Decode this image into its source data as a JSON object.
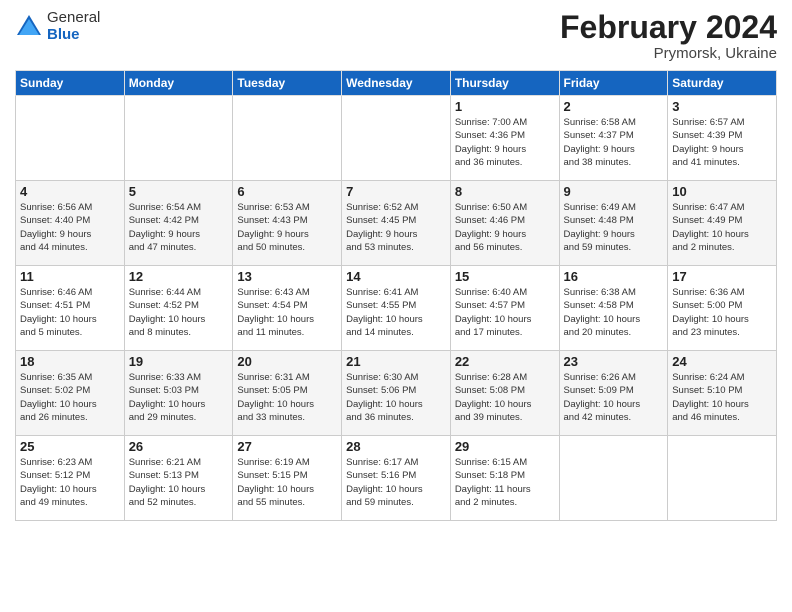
{
  "header": {
    "logo_general": "General",
    "logo_blue": "Blue",
    "month_title": "February 2024",
    "subtitle": "Prymorsk, Ukraine"
  },
  "days_of_week": [
    "Sunday",
    "Monday",
    "Tuesday",
    "Wednesday",
    "Thursday",
    "Friday",
    "Saturday"
  ],
  "weeks": [
    [
      {
        "day": "",
        "info": ""
      },
      {
        "day": "",
        "info": ""
      },
      {
        "day": "",
        "info": ""
      },
      {
        "day": "",
        "info": ""
      },
      {
        "day": "1",
        "info": "Sunrise: 7:00 AM\nSunset: 4:36 PM\nDaylight: 9 hours\nand 36 minutes."
      },
      {
        "day": "2",
        "info": "Sunrise: 6:58 AM\nSunset: 4:37 PM\nDaylight: 9 hours\nand 38 minutes."
      },
      {
        "day": "3",
        "info": "Sunrise: 6:57 AM\nSunset: 4:39 PM\nDaylight: 9 hours\nand 41 minutes."
      }
    ],
    [
      {
        "day": "4",
        "info": "Sunrise: 6:56 AM\nSunset: 4:40 PM\nDaylight: 9 hours\nand 44 minutes."
      },
      {
        "day": "5",
        "info": "Sunrise: 6:54 AM\nSunset: 4:42 PM\nDaylight: 9 hours\nand 47 minutes."
      },
      {
        "day": "6",
        "info": "Sunrise: 6:53 AM\nSunset: 4:43 PM\nDaylight: 9 hours\nand 50 minutes."
      },
      {
        "day": "7",
        "info": "Sunrise: 6:52 AM\nSunset: 4:45 PM\nDaylight: 9 hours\nand 53 minutes."
      },
      {
        "day": "8",
        "info": "Sunrise: 6:50 AM\nSunset: 4:46 PM\nDaylight: 9 hours\nand 56 minutes."
      },
      {
        "day": "9",
        "info": "Sunrise: 6:49 AM\nSunset: 4:48 PM\nDaylight: 9 hours\nand 59 minutes."
      },
      {
        "day": "10",
        "info": "Sunrise: 6:47 AM\nSunset: 4:49 PM\nDaylight: 10 hours\nand 2 minutes."
      }
    ],
    [
      {
        "day": "11",
        "info": "Sunrise: 6:46 AM\nSunset: 4:51 PM\nDaylight: 10 hours\nand 5 minutes."
      },
      {
        "day": "12",
        "info": "Sunrise: 6:44 AM\nSunset: 4:52 PM\nDaylight: 10 hours\nand 8 minutes."
      },
      {
        "day": "13",
        "info": "Sunrise: 6:43 AM\nSunset: 4:54 PM\nDaylight: 10 hours\nand 11 minutes."
      },
      {
        "day": "14",
        "info": "Sunrise: 6:41 AM\nSunset: 4:55 PM\nDaylight: 10 hours\nand 14 minutes."
      },
      {
        "day": "15",
        "info": "Sunrise: 6:40 AM\nSunset: 4:57 PM\nDaylight: 10 hours\nand 17 minutes."
      },
      {
        "day": "16",
        "info": "Sunrise: 6:38 AM\nSunset: 4:58 PM\nDaylight: 10 hours\nand 20 minutes."
      },
      {
        "day": "17",
        "info": "Sunrise: 6:36 AM\nSunset: 5:00 PM\nDaylight: 10 hours\nand 23 minutes."
      }
    ],
    [
      {
        "day": "18",
        "info": "Sunrise: 6:35 AM\nSunset: 5:02 PM\nDaylight: 10 hours\nand 26 minutes."
      },
      {
        "day": "19",
        "info": "Sunrise: 6:33 AM\nSunset: 5:03 PM\nDaylight: 10 hours\nand 29 minutes."
      },
      {
        "day": "20",
        "info": "Sunrise: 6:31 AM\nSunset: 5:05 PM\nDaylight: 10 hours\nand 33 minutes."
      },
      {
        "day": "21",
        "info": "Sunrise: 6:30 AM\nSunset: 5:06 PM\nDaylight: 10 hours\nand 36 minutes."
      },
      {
        "day": "22",
        "info": "Sunrise: 6:28 AM\nSunset: 5:08 PM\nDaylight: 10 hours\nand 39 minutes."
      },
      {
        "day": "23",
        "info": "Sunrise: 6:26 AM\nSunset: 5:09 PM\nDaylight: 10 hours\nand 42 minutes."
      },
      {
        "day": "24",
        "info": "Sunrise: 6:24 AM\nSunset: 5:10 PM\nDaylight: 10 hours\nand 46 minutes."
      }
    ],
    [
      {
        "day": "25",
        "info": "Sunrise: 6:23 AM\nSunset: 5:12 PM\nDaylight: 10 hours\nand 49 minutes."
      },
      {
        "day": "26",
        "info": "Sunrise: 6:21 AM\nSunset: 5:13 PM\nDaylight: 10 hours\nand 52 minutes."
      },
      {
        "day": "27",
        "info": "Sunrise: 6:19 AM\nSunset: 5:15 PM\nDaylight: 10 hours\nand 55 minutes."
      },
      {
        "day": "28",
        "info": "Sunrise: 6:17 AM\nSunset: 5:16 PM\nDaylight: 10 hours\nand 59 minutes."
      },
      {
        "day": "29",
        "info": "Sunrise: 6:15 AM\nSunset: 5:18 PM\nDaylight: 11 hours\nand 2 minutes."
      },
      {
        "day": "",
        "info": ""
      },
      {
        "day": "",
        "info": ""
      }
    ]
  ]
}
